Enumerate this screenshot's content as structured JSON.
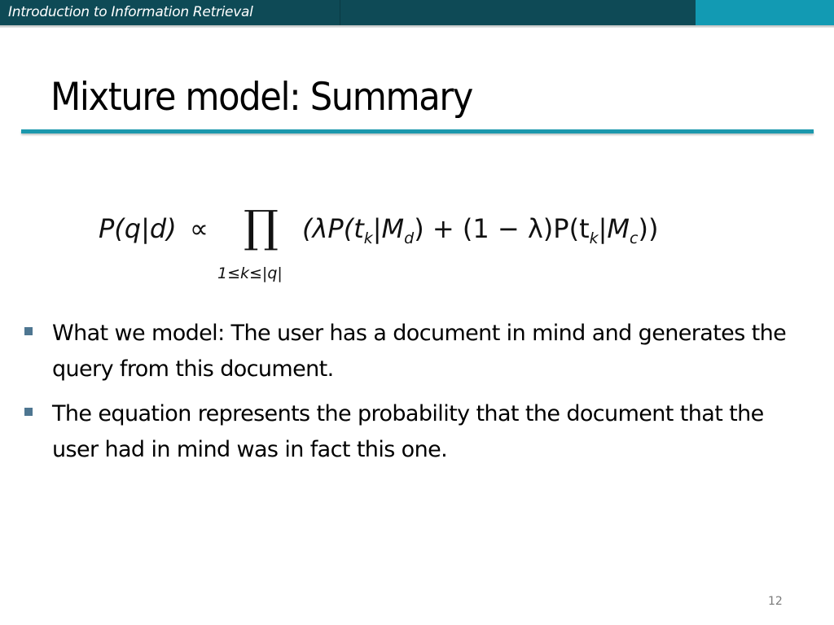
{
  "header": {
    "course_title": "Introduction to Information Retrieval",
    "bar_color": "#0e4a56",
    "accent_color": "#129ab3"
  },
  "slide": {
    "title": "Mixture model: Summary",
    "rule_color": "#1b98ad",
    "page_number": "12"
  },
  "equation": {
    "lhs": "P(q|d)",
    "relation": "∝",
    "operator": "∏",
    "limits": "1≤k≤|q|",
    "rhs_open": "(λP(t",
    "rhs_sub_k1": "k",
    "rhs_mid1": "|M",
    "rhs_sub_d": "d",
    "rhs_mid2": ") + (1 − λ)P(t",
    "rhs_sub_k2": "k",
    "rhs_mid3": "|M",
    "rhs_sub_c": "c",
    "rhs_close": "))",
    "latex": "P(q|d) \\propto \\prod_{1 \\le k \\le |q|} (\\lambda P(t_k|M_d) + (1-\\lambda) P(t_k|M_c))"
  },
  "bullets": [
    {
      "text": "What we model: The user has a document in mind and generates the query from this document."
    },
    {
      "text": "The equation represents the probability that the document that the user had in mind was in fact this one."
    }
  ],
  "bullet_color": "#4e7691"
}
